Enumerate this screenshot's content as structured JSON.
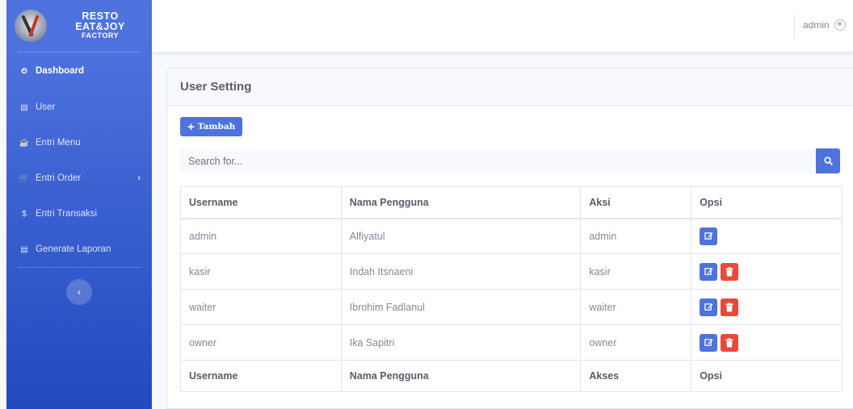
{
  "brand": {
    "line1": "RESTO EAT&JOY",
    "line2": "FACTORY"
  },
  "sidebar": {
    "items": [
      {
        "label": "Dashboard",
        "icon": "dashboard-icon",
        "glyph": "⏲"
      },
      {
        "label": "User",
        "icon": "user-icon",
        "glyph": "▤"
      },
      {
        "label": "Entri Menu",
        "icon": "menu-icon",
        "glyph": "☕"
      },
      {
        "label": "Entri Order",
        "icon": "cart-icon",
        "glyph": "🛒"
      },
      {
        "label": "Entri Transaksi",
        "icon": "dollar-icon",
        "glyph": "$"
      },
      {
        "label": "Generate Laporan",
        "icon": "report-icon",
        "glyph": "▤"
      }
    ],
    "toggle_glyph": "‹",
    "caret_glyph": "›"
  },
  "topbar": {
    "username": "admin"
  },
  "card": {
    "title": "User Setting",
    "add_button_label": "Tambah",
    "add_button_glyph": "+",
    "search_placeholder": "Search for..."
  },
  "table": {
    "headers": [
      "Username",
      "Nama Pengguna",
      "Aksi",
      "Opsi"
    ],
    "footers": [
      "Username",
      "Nama Pengguna",
      "Akses",
      "Opsi"
    ],
    "rows": [
      {
        "username": "admin",
        "nama": "Alfiyatul",
        "aksi": "admin",
        "can_delete": false
      },
      {
        "username": "kasir",
        "nama": "Indah Itsnaeni",
        "aksi": "kasir",
        "can_delete": true
      },
      {
        "username": "waiter",
        "nama": "Ibrohim Fadlanul",
        "aksi": "waiter",
        "can_delete": true
      },
      {
        "username": "owner",
        "nama": "Ika Sapitri",
        "aksi": "owner",
        "can_delete": true
      }
    ]
  },
  "colors": {
    "primary": "#4e73df",
    "danger": "#e74a3b",
    "sidebar_end": "#224abe"
  }
}
